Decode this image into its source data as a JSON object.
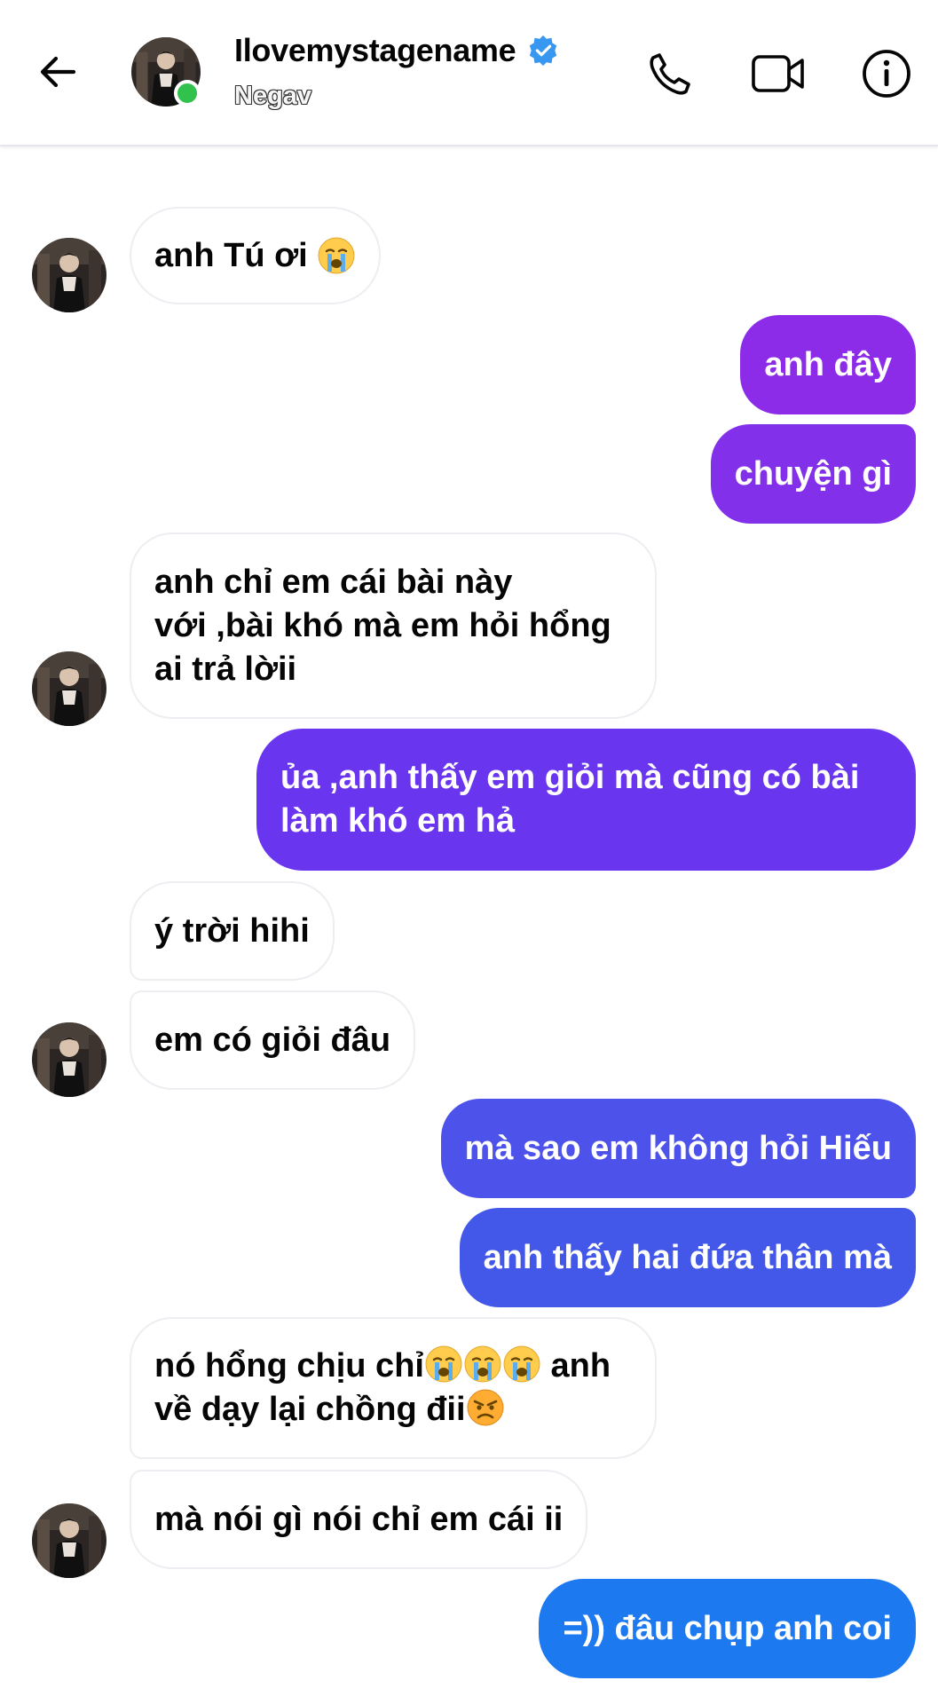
{
  "header": {
    "contact_name": "Ilovemystagename",
    "subtitle": "Negav",
    "verified": true,
    "online": true,
    "icons": [
      "back-arrow-icon",
      "phone-icon",
      "video-camera-icon",
      "info-icon",
      "verified-badge-icon"
    ]
  },
  "colors": {
    "incoming_bg": "#ffffff",
    "incoming_text": "#050505",
    "outgoing_gradient": [
      "#8a2be2",
      "#6a35ee",
      "#4e4fe8",
      "#2f6fe6",
      "#1c7bef"
    ],
    "online_green": "#31c24d",
    "verified_blue": "#3897f0"
  },
  "messages": [
    {
      "dir": "in",
      "text": "anh Tú ơi",
      "emoji_after": "loudly-crying-face"
    },
    {
      "dir": "out",
      "text": "anh đây"
    },
    {
      "dir": "out",
      "text": "chuyện gì"
    },
    {
      "dir": "in",
      "line1": "anh chỉ em cái bài này",
      "line2": "với ,bài khó mà em hỏi hổng",
      "line3": "ai trả lờii"
    },
    {
      "dir": "out",
      "line1": "ủa ,anh thấy em giỏi mà cũng có bài",
      "line2": "làm khó em hả"
    },
    {
      "dir": "in",
      "text": "ý trời hihi"
    },
    {
      "dir": "in",
      "text": "em có giỏi đâu"
    },
    {
      "dir": "out",
      "text": "mà sao em không hỏi Hiếu"
    },
    {
      "dir": "out",
      "text": "anh thấy hai đứa thân mà"
    },
    {
      "dir": "in",
      "line1_start": "nó hổng chịu chỉ",
      "line1_end": "anh",
      "line2": "về dạy lại chồng đii",
      "emojis": [
        "loudly-crying-face",
        "loudly-crying-face",
        "loudly-crying-face",
        "angry-face"
      ]
    },
    {
      "dir": "in",
      "text": "mà nói gì nói chỉ em cái ii"
    },
    {
      "dir": "out",
      "text": "=)) đâu chụp anh coi"
    }
  ]
}
